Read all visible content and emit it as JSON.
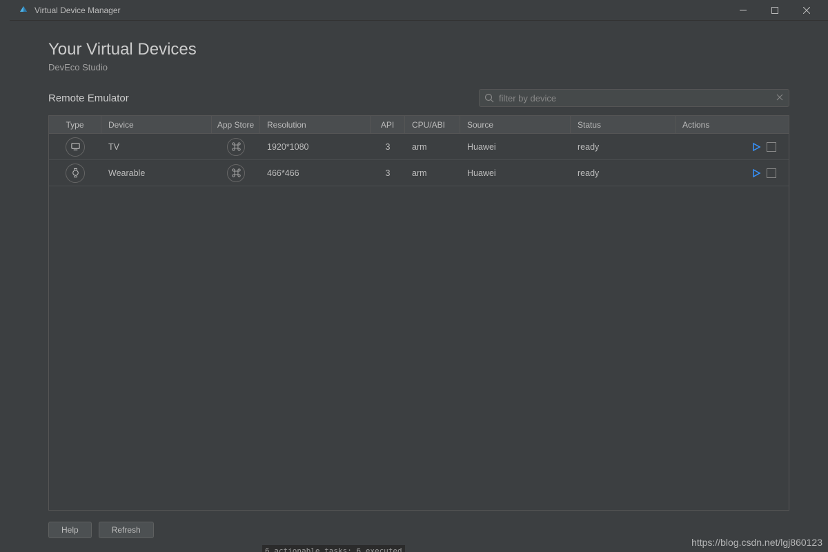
{
  "window": {
    "title": "Virtual Device Manager"
  },
  "header": {
    "heading": "Your Virtual Devices",
    "subheading": "DevEco Studio"
  },
  "section": {
    "title": "Remote Emulator"
  },
  "search": {
    "placeholder": "filter by device",
    "value": ""
  },
  "columns": {
    "type": "Type",
    "device": "Device",
    "appstore": "App Store",
    "resolution": "Resolution",
    "api": "API",
    "cpu": "CPU/ABI",
    "source": "Source",
    "status": "Status",
    "actions": "Actions"
  },
  "rows": [
    {
      "type_icon": "tv",
      "device": "TV",
      "resolution": "1920*1080",
      "api": "3",
      "cpu": "arm",
      "source": "Huawei",
      "status": "ready"
    },
    {
      "type_icon": "wearable",
      "device": "Wearable",
      "resolution": "466*466",
      "api": "3",
      "cpu": "arm",
      "source": "Huawei",
      "status": "ready"
    }
  ],
  "buttons": {
    "help": "Help",
    "refresh": "Refresh"
  },
  "watermark": "https://blog.csdn.net/lgj860123",
  "terminal": "6 actionable tasks: 6 executed"
}
